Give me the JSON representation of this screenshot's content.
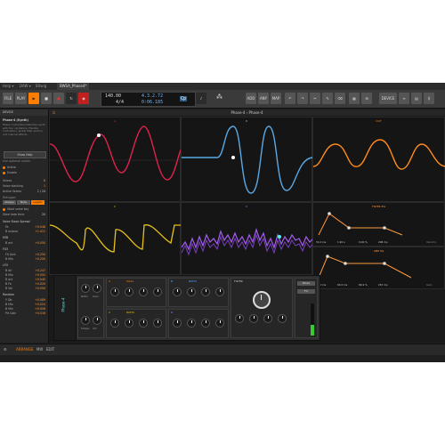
{
  "window": {
    "menu_items": [
      "Help ▾",
      "DAW ▾",
      "Bitwig"
    ],
    "project_tab": "BWSA_Phase4*"
  },
  "toolbar": {
    "file_label": "FILE",
    "play_label": "PLAY",
    "arrange_labels": [
      "ARR",
      "MIX",
      "EDIT"
    ],
    "right_buttons": [
      "ADD",
      "ANY",
      "MAP",
      "DEVICE"
    ]
  },
  "transport": {
    "tempo": "140.00",
    "signature": "4/4",
    "position": "4.3.2.72",
    "time": "0:06.185",
    "mode": "Cp"
  },
  "left_panel": {
    "header": "DEVICE",
    "device_name": "Phase-4 (Synth)",
    "description": "Phase modulation/distortion synth with four oscillators. Flexible modulation, global filter section, and internal effects.",
    "help_button": "Show Help",
    "options_label": "Use optional voices",
    "toggles": [
      "Active",
      "Enable"
    ],
    "voices_label": "Voices",
    "voices_value": "8",
    "voice_stacking_label": "Voice stacking",
    "voice_stacking_value": "1",
    "active_voices_label": "Active Voices",
    "active_voices_value": "1 / 24",
    "retrigger_label": "Retrigger",
    "retrigger_options": [
      "Always",
      "Note",
      "Legato"
    ],
    "steal_label": "Steal same key",
    "fade_time_label": "Steal fade time",
    "fade_time_value": "20",
    "mod_sections": [
      {
        "title": "Voice Stack Spread",
        "rows": [
          [
            "Fa",
            "+0.048"
          ],
          [
            "B octave",
            "+1.411"
          ]
        ]
      },
      {
        "title": "MID",
        "rows": [
          [
            "B oct",
            "+0.050"
          ]
        ]
      },
      {
        "title": "FX3",
        "rows": [
          [
            "FX Amt",
            "+0.250"
          ],
          [
            "B Mix",
            "+0.200"
          ]
        ]
      },
      {
        "title": "LFO",
        "rows": [
          [
            "B dir",
            "+0.247"
          ],
          [
            "B Mix",
            "+0.052"
          ],
          [
            "B oct",
            "+0.040"
          ],
          [
            "B Fa",
            "+0.020"
          ],
          [
            "B Vol",
            "+0.050"
          ]
        ]
      },
      {
        "title": "Random",
        "rows": [
          [
            "Y Db",
            "+0.089"
          ],
          [
            "B Mix",
            "+0.024"
          ],
          [
            "B Mix",
            "+0.006"
          ],
          [
            "Pit Gain",
            "+0.016"
          ]
        ]
      }
    ]
  },
  "main": {
    "header": "Phase-4 › Phase-4",
    "scopes": [
      {
        "label": "A",
        "color": "#e0234b"
      },
      {
        "label": "B",
        "color": "#5aa9e6"
      },
      {
        "label": "OUT",
        "color": "#ff8a1c"
      },
      {
        "label": "C",
        "color": "#e8c21a"
      },
      {
        "label": "D",
        "color": "#a35cf0"
      }
    ],
    "envelopes": [
      {
        "title": "FILTER EG",
        "values": [
          "31.0 ms",
          "1.90 s",
          "0.00 %",
          "208 ms"
        ],
        "extra": "Velocity"
      },
      {
        "title": "AMP EG",
        "values": [
          "2.50 ms",
          "60.0 ms",
          "66.9 %",
          "215 ms"
        ],
        "extra": "Gain"
      }
    ]
  },
  "rack": {
    "title": "Phase-4",
    "osc_labels": [
      "A",
      "B",
      "C",
      "D"
    ],
    "section_labels": [
      "Mode",
      "RATIO",
      "RATIO",
      "FILTER"
    ],
    "knob_labels": [
      "Ratio",
      "Gain",
      "Shape",
      "Vol"
    ],
    "right_buttons": [
      "Mode",
      "FX"
    ]
  },
  "bottom": {
    "items": [
      "ARRANGE",
      "MIX",
      "EDIT"
    ]
  }
}
